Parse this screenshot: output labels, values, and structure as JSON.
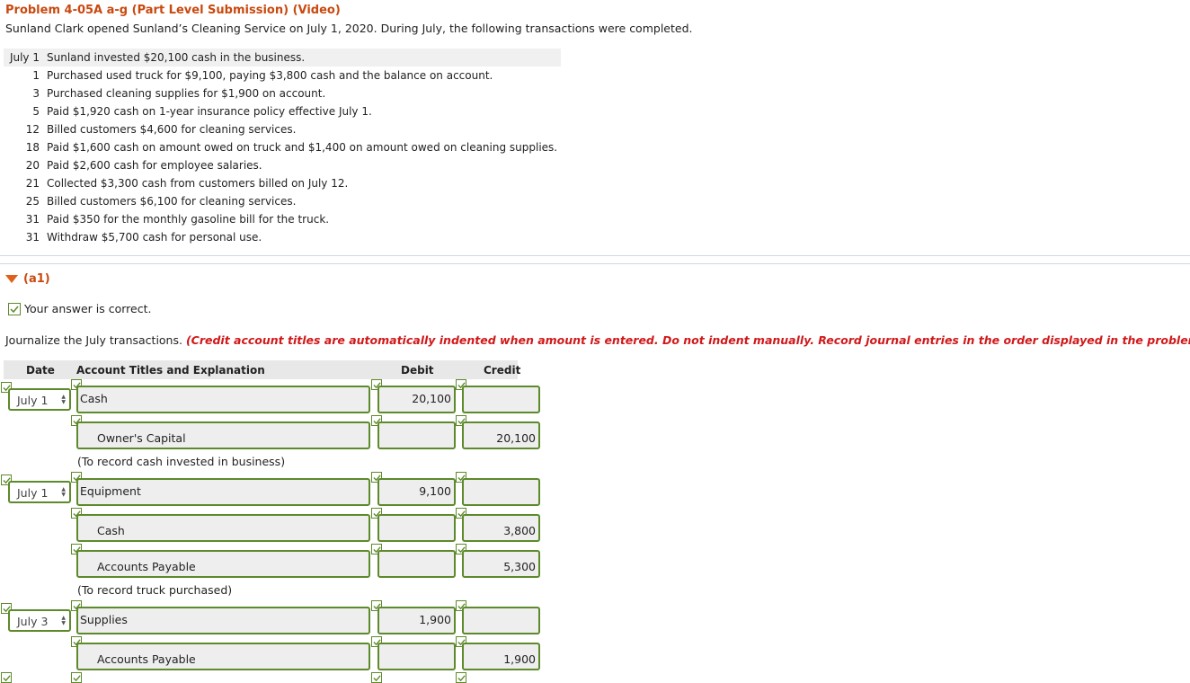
{
  "problem": {
    "title": "Problem 4-05A a-g (Part Level Submission) (Video)",
    "intro": "Sunland Clark opened Sunland’s Cleaning Service on July 1, 2020. During July, the following transactions were completed.",
    "transactions": [
      {
        "month": "July",
        "day": "1",
        "text": "Sunland invested $20,100 cash in the business."
      },
      {
        "month": "",
        "day": "1",
        "text": "Purchased used truck for $9,100, paying $3,800 cash and the balance on account."
      },
      {
        "month": "",
        "day": "3",
        "text": "Purchased cleaning supplies for $1,900 on account."
      },
      {
        "month": "",
        "day": "5",
        "text": "Paid $1,920 cash on 1-year insurance policy effective July 1."
      },
      {
        "month": "",
        "day": "12",
        "text": "Billed customers $4,600 for cleaning services."
      },
      {
        "month": "",
        "day": "18",
        "text": "Paid $1,600 cash on amount owed on truck and $1,400 on amount owed on cleaning supplies."
      },
      {
        "month": "",
        "day": "20",
        "text": "Paid $2,600 cash for employee salaries."
      },
      {
        "month": "",
        "day": "21",
        "text": "Collected $3,300 cash from customers billed on July 12."
      },
      {
        "month": "",
        "day": "25",
        "text": "Billed customers $6,100 for cleaning services."
      },
      {
        "month": "",
        "day": "31",
        "text": "Paid $350 for the monthly gasoline bill for the truck."
      },
      {
        "month": "",
        "day": "31",
        "text": "Withdraw $5,700 cash for personal use."
      }
    ]
  },
  "part": {
    "label": "(a1)",
    "status": "Your answer is correct.",
    "instruction": "Journalize the July transactions.",
    "instruction_note": "(Credit account titles are automatically indented when amount is entered. Do not indent manually. Record journal entries in the order displayed in the problem.)"
  },
  "journal": {
    "headers": {
      "date": "Date",
      "account": "Account Titles and Explanation",
      "debit": "Debit",
      "credit": "Credit"
    },
    "entries": [
      {
        "date": "July 1",
        "lines": [
          {
            "account": "Cash",
            "debit": "20,100",
            "credit": ""
          },
          {
            "account": "Owner's Capital",
            "debit": "",
            "credit": "20,100"
          }
        ],
        "explanation": "(To record cash invested in business)"
      },
      {
        "date": "July 1",
        "lines": [
          {
            "account": "Equipment",
            "debit": "9,100",
            "credit": ""
          },
          {
            "account": "Cash",
            "debit": "",
            "credit": "3,800"
          },
          {
            "account": "Accounts Payable",
            "debit": "",
            "credit": "5,300"
          }
        ],
        "explanation": "(To record truck purchased)"
      },
      {
        "date": "July 3",
        "lines": [
          {
            "account": "Supplies",
            "debit": "1,900",
            "credit": ""
          },
          {
            "account": "Accounts Payable",
            "debit": "",
            "credit": "1,900"
          }
        ]
      }
    ]
  },
  "colors": {
    "title": "#c9490f",
    "note": "#d0181a",
    "correct_border": "#5d8a2b"
  }
}
